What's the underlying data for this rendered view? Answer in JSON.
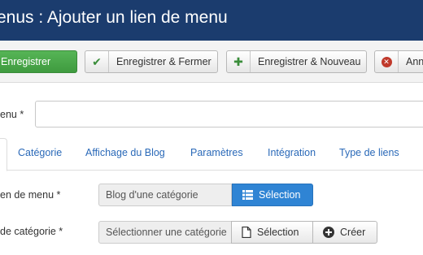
{
  "header": {
    "title": "enus : Ajouter un lien de menu"
  },
  "toolbar": {
    "save_label": "Enregistrer",
    "save_close_label": "Enregistrer & Fermer",
    "save_new_label": "Enregistrer & Nouveau",
    "cancel_label": "Ann"
  },
  "form": {
    "title_label": "enu *",
    "title_value": ""
  },
  "tabs": [
    "Catégorie",
    "Affichage du Blog",
    "Paramètres",
    "Intégration",
    "Type de liens"
  ],
  "fields": {
    "menu_item_type": {
      "label": "en de menu *",
      "value": "Blog d'une catégorie",
      "select_button": "Sélection"
    },
    "category": {
      "label": "de catégorie *",
      "value": "Sélectionner une catégorie",
      "select_button": "Sélection",
      "create_button": "Créer"
    }
  },
  "colors": {
    "header_bg": "#1b3c6e",
    "save_green": "#4aa94a",
    "select_blue": "#2f84d4",
    "tab_link": "#2a69b8"
  },
  "icons": {
    "save_close": "check-icon",
    "save_new": "plus-icon",
    "cancel": "cancel-circle-icon",
    "type_select": "list-icon",
    "category_select": "file-icon",
    "category_create": "plus-circle-icon"
  }
}
